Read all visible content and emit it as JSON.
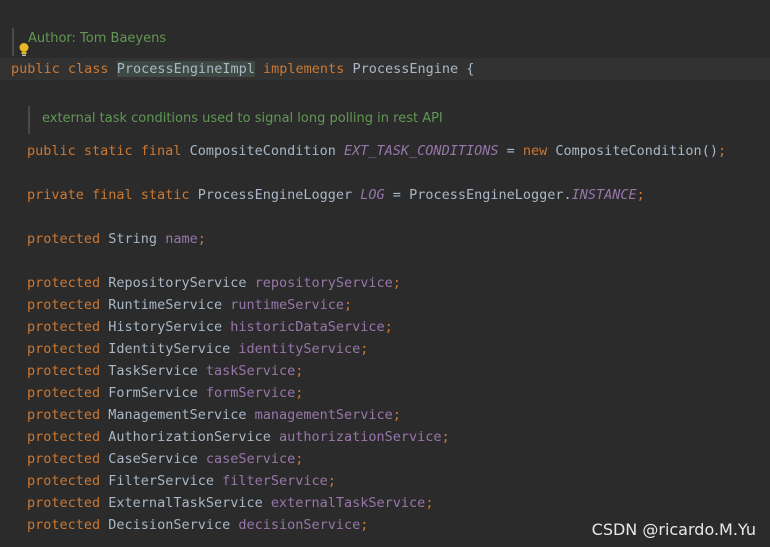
{
  "author_doc": "Author: Tom Baeyens",
  "class_decl": {
    "kw_public": "public",
    "kw_class": "class",
    "class_name": "ProcessEngineImpl",
    "kw_implements": "implements",
    "interface_name": "ProcessEngine",
    "brace": " {"
  },
  "field_doc": "external task conditions used to signal long polling in rest API",
  "line_ext": {
    "mods": "public static final",
    "type": "CompositeCondition",
    "name": "EXT_TASK_CONDITIONS",
    "eq": " = ",
    "kw_new": "new",
    "init": "CompositeCondition()",
    "semi": ";"
  },
  "line_log": {
    "mods": "private final static",
    "type": "ProcessEngineLogger",
    "name": "LOG",
    "eq": " = ",
    "init_class": "ProcessEngineLogger.",
    "init_field": "INSTANCE",
    "semi": ";"
  },
  "line_name": {
    "mod": "protected",
    "type": "String",
    "name": "name",
    "semi": ";"
  },
  "fields": [
    {
      "mod": "protected",
      "type": "RepositoryService",
      "name": "repositoryService",
      "semi": ";"
    },
    {
      "mod": "protected",
      "type": "RuntimeService",
      "name": "runtimeService",
      "semi": ";"
    },
    {
      "mod": "protected",
      "type": "HistoryService",
      "name": "historicDataService",
      "semi": ";"
    },
    {
      "mod": "protected",
      "type": "IdentityService",
      "name": "identityService",
      "semi": ";"
    },
    {
      "mod": "protected",
      "type": "TaskService",
      "name": "taskService",
      "semi": ";"
    },
    {
      "mod": "protected",
      "type": "FormService",
      "name": "formService",
      "semi": ";"
    },
    {
      "mod": "protected",
      "type": "ManagementService",
      "name": "managementService",
      "semi": ";"
    },
    {
      "mod": "protected",
      "type": "AuthorizationService",
      "name": "authorizationService",
      "semi": ";"
    },
    {
      "mod": "protected",
      "type": "CaseService",
      "name": "caseService",
      "semi": ";"
    },
    {
      "mod": "protected",
      "type": "FilterService",
      "name": "filterService",
      "semi": ";"
    },
    {
      "mod": "protected",
      "type": "ExternalTaskService",
      "name": "externalTaskService",
      "semi": ";"
    },
    {
      "mod": "protected",
      "type": "DecisionService",
      "name": "decisionService",
      "semi": ";"
    }
  ],
  "watermark": "CSDN @ricardo.M.Yu",
  "colors": {
    "background": "#2b2b2b",
    "keyword": "#cc7832",
    "field": "#9876aa",
    "doc_comment": "#629755",
    "text": "#a9b7c6"
  }
}
